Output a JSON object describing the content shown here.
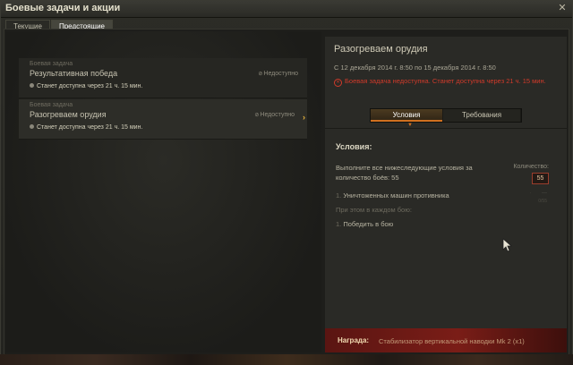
{
  "window": {
    "title": "Боевые задачи и акции",
    "close_label": "✕"
  },
  "tabs": [
    {
      "label": "Текущие",
      "active": false
    },
    {
      "label": "Предстоящие",
      "active": true
    }
  ],
  "tasks": [
    {
      "type": "Боевая задача",
      "name": "Результативная победа",
      "availability": "Недоступно",
      "status": "Станет доступна через 21 ч. 15 мин."
    },
    {
      "type": "Боевая задача",
      "name": "Разогреваем орудия",
      "availability": "Недоступно",
      "status": "Станет доступна через 21 ч. 15 мин."
    }
  ],
  "detail": {
    "title": "Разогреваем орудия",
    "dates": "С 12 декабря 2014 г. 8:50 по 15 декабря 2014 г. 8:50",
    "warning": "Боевая задача недоступна. Станет доступна через 21 ч. 15 мин.",
    "segment": [
      "Условия",
      "Требования"
    ],
    "conditions_heading": "Условия:",
    "conditions_text": "Выполните все нижеследующие условия за количество боёв: 55",
    "quantity_label": "Количество:",
    "quantity_value": "55",
    "condition_items": [
      {
        "num": "1.",
        "text": "Уничтоженных машин противника"
      }
    ],
    "each_battle_label": "При этом в каждом бою:",
    "each_battle_items": [
      {
        "num": "1.",
        "text": "Победить в бою"
      }
    ],
    "reward_label": "Награда:",
    "reward_value": "Стабилизатор вертикальной наводки Mk 2 (x1)"
  },
  "colors": {
    "accent_orange": "#d07020",
    "warning_red": "#d03a2a",
    "reward_bg": "#7a1d17"
  },
  "icons": [
    "close-icon",
    "unavailable-icon",
    "status-dot-icon",
    "chevron-right-icon",
    "warning-icon",
    "cursor-icon"
  ]
}
